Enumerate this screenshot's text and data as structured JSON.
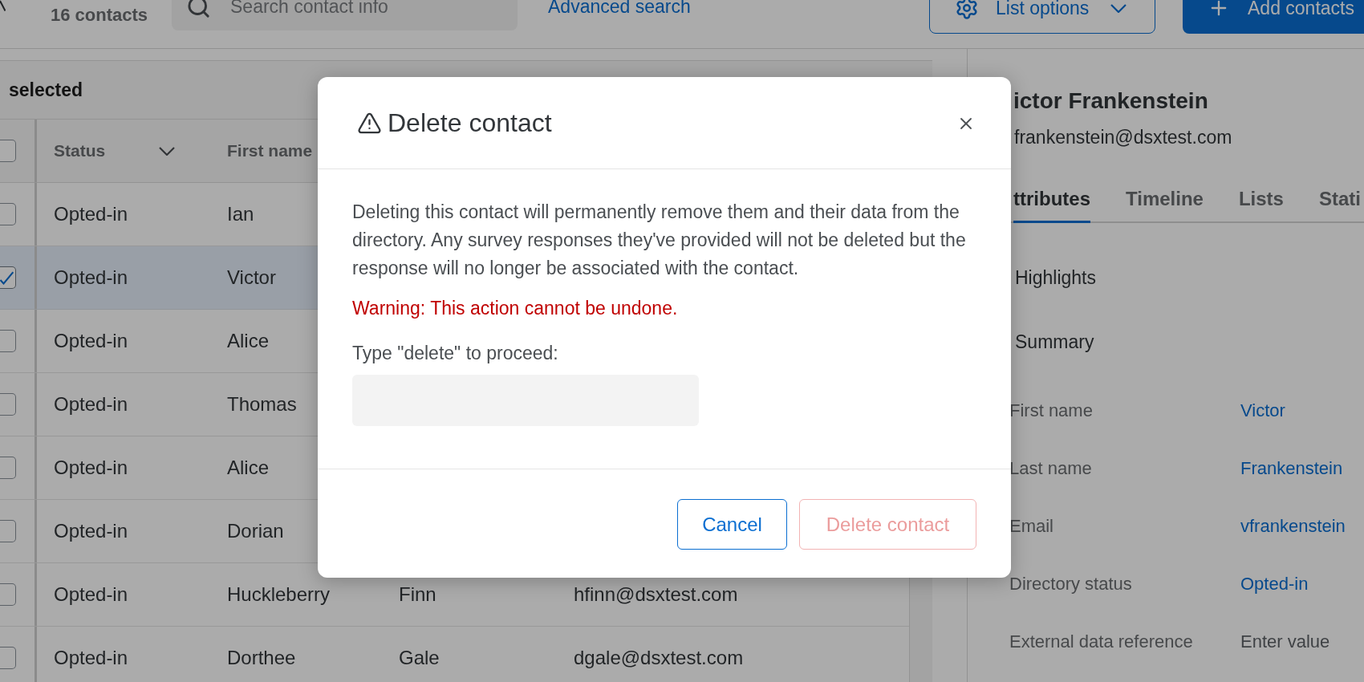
{
  "header": {
    "contact_count": "16 contacts",
    "search": {
      "placeholder": "Search contact info"
    },
    "advanced_search": "Advanced search",
    "list_options": "List options",
    "add_contacts": "Add contacts"
  },
  "table": {
    "selection_summary": "selected",
    "select_all_checked": false,
    "columns": [
      {
        "label": "Status",
        "kind": "sortable"
      },
      {
        "label": "First name",
        "kind": "plain"
      }
    ],
    "rows": [
      {
        "checked": false,
        "selected": false,
        "status": "Opted-in",
        "first_name": "Ian"
      },
      {
        "checked": true,
        "selected": true,
        "status": "Opted-in",
        "first_name": "Victor"
      },
      {
        "checked": false,
        "selected": false,
        "status": "Opted-in",
        "first_name": "Alice"
      },
      {
        "checked": false,
        "selected": false,
        "status": "Opted-in",
        "first_name": "Thomas"
      },
      {
        "checked": false,
        "selected": false,
        "status": "Opted-in",
        "first_name": "Alice"
      },
      {
        "checked": false,
        "selected": false,
        "status": "Opted-in",
        "first_name": "Dorian"
      },
      {
        "checked": false,
        "selected": false,
        "status": "Opted-in",
        "first_name": "Huckleberry",
        "last_name": "Finn",
        "email": "hfinn@dsxtest.com"
      },
      {
        "checked": false,
        "selected": false,
        "status": "Opted-in",
        "first_name": "Dorthee",
        "last_name": "Gale",
        "email": "dgale@dsxtest.com"
      }
    ]
  },
  "detail": {
    "name": "ictor Frankenstein",
    "email": "frankenstein@dsxtest.com",
    "tabs": [
      {
        "label": "ttributes",
        "selected": true
      },
      {
        "label": "Timeline",
        "selected": false
      },
      {
        "label": "Lists",
        "selected": false
      },
      {
        "label": "Stati",
        "selected": false
      }
    ],
    "sections": [
      "Highlights",
      "Summary"
    ],
    "fields": [
      {
        "label": "First name",
        "kind": "value",
        "value": "Victor"
      },
      {
        "label": "Last name",
        "kind": "value",
        "value": "Frankenstein"
      },
      {
        "label": "Email",
        "kind": "value",
        "value": "vfrankenstein"
      },
      {
        "label": "Directory status",
        "kind": "value",
        "value": "Opted-in"
      },
      {
        "label": "External data reference",
        "kind": "input",
        "placeholder": "Enter value"
      }
    ]
  },
  "dialog": {
    "title": "Delete contact",
    "message": "Deleting this contact will permanently remove them and their data from the directory. Any survey responses they've provided will not be deleted but the response will no longer be associated with the contact.",
    "warning": "Warning: This action cannot be undone.",
    "confirm_label": "Type \"delete\" to proceed:",
    "buttons": [
      {
        "label": "Cancel",
        "kind": "secondary",
        "disabled": false
      },
      {
        "label": "Delete contact",
        "kind": "danger",
        "disabled": true
      }
    ]
  }
}
